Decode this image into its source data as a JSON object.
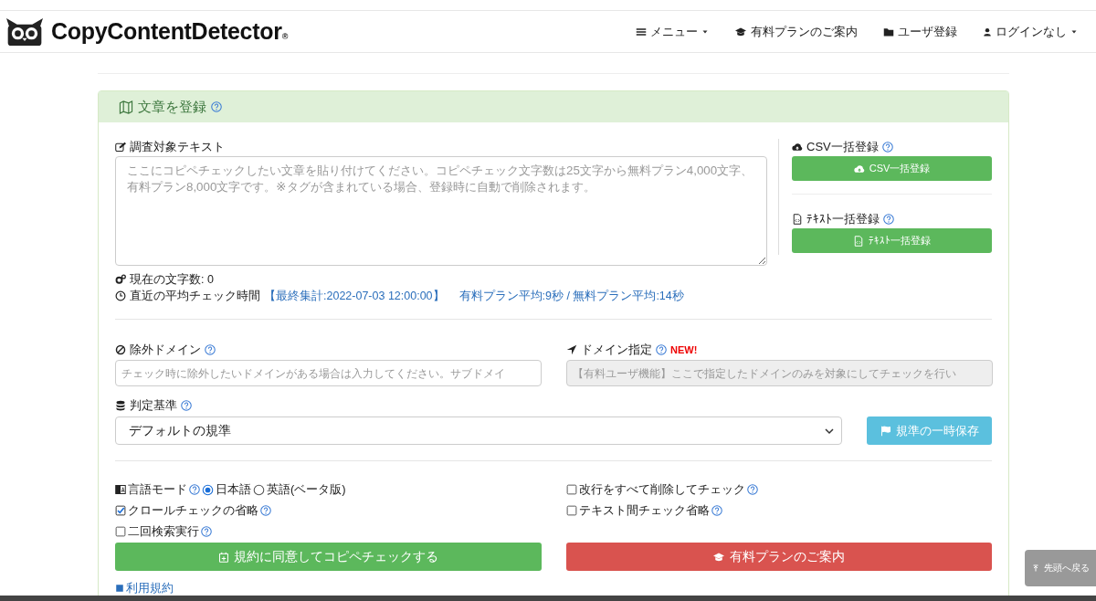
{
  "header": {
    "logo": "CopyContentDetector",
    "logo_mark": "®",
    "nav": [
      {
        "label": "メニュー",
        "kind": "dropdown"
      },
      {
        "label": "有料プランのご案内",
        "kind": "link"
      },
      {
        "label": "ユーザ登録",
        "kind": "link"
      },
      {
        "label": "ログインなし",
        "kind": "dropdown"
      }
    ]
  },
  "panel": {
    "title": "文章を登録",
    "text_input": {
      "label": "調査対象テキスト",
      "placeholder": "ここにコピペチェックしたい文章を貼り付けてください。コピペチェック文字数は25文字から無料プラン4,000文字、有料プラン8,000文字です。※タグが含まれている場合、登録時に自動で削除されます。"
    },
    "char_count": "現在の文字数: 0",
    "avg_time": {
      "label": "直近の平均チェック時間",
      "last": "【最終集計:2022-07-03 12:00:00】",
      "stats": "有料プラン平均:9秒 / 無料プラン平均:14秒"
    },
    "bulk": [
      {
        "label": "CSV一括登録",
        "button": "CSV一括登録"
      },
      {
        "label": "ﾃｷｽﾄ一括登録",
        "button": "ﾃｷｽﾄ一括登録"
      }
    ],
    "exclude_domain": {
      "label": "除外ドメイン",
      "placeholder": "チェック時に除外したいドメインがある場合は入力してください。サブドメイ",
      "disabled": false
    },
    "domain_filter": {
      "label": "ドメイン指定",
      "badge": "NEW!",
      "placeholder": "【有料ユーザ機能】ここで指定したドメインのみを対象にしてチェックを行い",
      "disabled": true
    },
    "criteria": {
      "label": "判定基準",
      "value": "デフォルトの規準",
      "button": "規準の一時保存"
    },
    "language": {
      "label": "言語モード",
      "choices": [
        {
          "label": "日本語",
          "selected": true
        },
        {
          "label": "英語(ベータ版)",
          "selected": false
        }
      ]
    },
    "options_left": [
      {
        "label": "クロールチェックの省略",
        "checked": true
      },
      {
        "label": "二回検索実行",
        "checked": false
      }
    ],
    "options_right": [
      {
        "label": "改行をすべて削除してチェック",
        "checked": false
      },
      {
        "label": "テキスト間チェック省略",
        "checked": false
      }
    ],
    "actions": [
      {
        "label": "規約に同意してコピペチェックする",
        "kind": "primary"
      },
      {
        "label": "有料プランのご案内",
        "kind": "danger"
      }
    ],
    "terms_link": "利用規約"
  },
  "back_to_top": "先頭へ戻る"
}
